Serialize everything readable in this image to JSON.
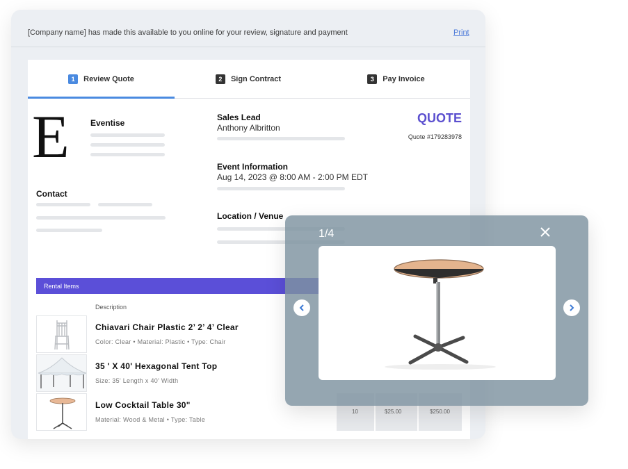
{
  "topbar": {
    "message": "[Company name] has made this available to you online for your review, signature and payment",
    "print_label": "Print"
  },
  "tabs": [
    {
      "number": "1",
      "label": "Review Quote",
      "active": true
    },
    {
      "number": "2",
      "label": "Sign Contract",
      "active": false
    },
    {
      "number": "3",
      "label": "Pay Invoice",
      "active": false
    }
  ],
  "company": {
    "logo_letter": "E",
    "name": "Eventise"
  },
  "contact": {
    "title": "Contact"
  },
  "sales_lead": {
    "title": "Sales Lead",
    "value": "Anthony Albritton"
  },
  "event_information": {
    "title": "Event Information",
    "value": "Aug 14, 2023 @ 8:00 AM - 2:00 PM EDT"
  },
  "location": {
    "title": "Location / Venue"
  },
  "quote": {
    "title": "QUOTE",
    "number": "Quote #179283978"
  },
  "rental_items": {
    "section_label": "Rental Items",
    "description_header": "Description",
    "items": [
      {
        "name": "Chiavari Chair Plastic 2’ 2’ 4’ Clear",
        "meta": "Color: Clear •  Material: Plastic • Type: Chair",
        "thumb_icon": "chair-icon"
      },
      {
        "name": "35 ' X 40' Hexagonal Tent Top",
        "meta": "Size: 35' Length x 40' Width",
        "thumb_icon": "tent-icon"
      },
      {
        "name": "Low Cocktail Table 30\"",
        "meta": "Material: Wood & Metal • Type: Table",
        "thumb_icon": "table-icon"
      }
    ],
    "price_row": {
      "qty": "10",
      "unit_price": "$25.00",
      "total": "$250.00"
    }
  },
  "lightbox": {
    "counter": "1/4",
    "close_icon": "close-icon",
    "prev_icon": "chevron-left-icon",
    "next_icon": "chevron-right-icon",
    "image_icon": "cocktail-table-icon"
  },
  "colors": {
    "accent_blue": "#4a8ae0",
    "quote_purple": "#5b4fcf",
    "rental_bar": "#5b4fd8",
    "lightbox_bg": "#7e92a0"
  }
}
